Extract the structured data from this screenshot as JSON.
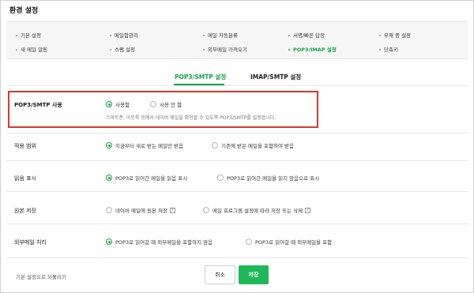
{
  "header": {
    "title": "환경 설정"
  },
  "nav": {
    "items": [
      {
        "label": "기본 설정"
      },
      {
        "label": "메일함관리"
      },
      {
        "label": "메일 자동분류"
      },
      {
        "label": "서명/빠른 답장"
      },
      {
        "label": "부재 중 설정"
      },
      {
        "label": "새 메일 알림"
      },
      {
        "label": "스팸 설정"
      },
      {
        "label": "외부메일 가져오기"
      },
      {
        "label": "POP3/IMAP 설정",
        "active": true
      },
      {
        "label": "단축키"
      }
    ]
  },
  "tabs": [
    {
      "label": "POP3/SMTP 설정",
      "active": true
    },
    {
      "label": "IMAP/SMTP 설정",
      "active": false
    }
  ],
  "settings": {
    "pop3": {
      "label": "POP3/SMTP 사용",
      "options": [
        "사용함",
        "사용 안 함"
      ],
      "selected": 0,
      "description": "스마트폰, 아웃룩 등에서 네이버 메일을 확인할 수 있도록 POP3/SMTP를 설정합니다."
    },
    "scope": {
      "label": "적용 범위",
      "options": [
        "지금부터 새로 받는 메일만 받음",
        "기존에 받은 메일을 포함하여 받음"
      ],
      "selected": 0
    },
    "read": {
      "label": "읽음 표시",
      "options": [
        "POP3로 읽어간 메일을 읽음 표시",
        "POP3로 읽어간 메일을 읽지 않음으로 표시"
      ],
      "selected": 0
    },
    "keep": {
      "label": "원본 저장",
      "options": [
        "네이버 메일에 원본 저장",
        "메일 프로그램 설정에 따라 저장 또는 삭제"
      ],
      "selected": -1,
      "help": "?"
    },
    "external": {
      "label": "외부메일 처리",
      "options": [
        "POP3로 읽어갈 때 외부메일을 포함하지 않음",
        "POP3로 읽어갈 때 외부메일을 포함"
      ],
      "selected": 0
    }
  },
  "footer": {
    "reset_label": "기본 설정으로 되돌리기",
    "cancel_label": "취소",
    "save_label": "저장"
  },
  "colors": {
    "accent": "#1aa34a",
    "highlight": "#d9382c"
  }
}
